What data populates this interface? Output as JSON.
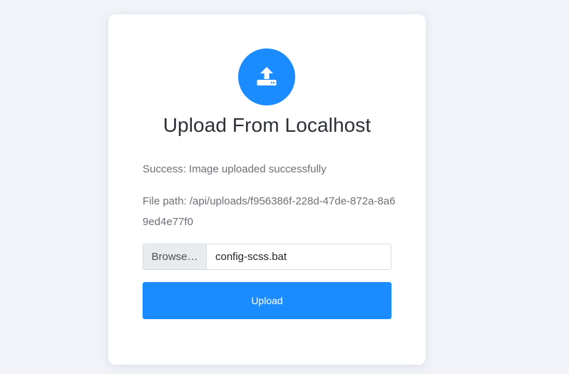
{
  "card": {
    "icon": "upload-icon",
    "title": "Upload From Localhost",
    "success_message": "Success: Image uploaded successfully",
    "file_path": "File path: /api/uploads/f956386f-228d-47de-872a-8a69ed4e77f0",
    "browse_label": "Browse…",
    "selected_file": "config-scss.bat",
    "upload_label": "Upload"
  },
  "colors": {
    "accent": "#1a8cff",
    "background": "#f1f3f9",
    "card": "#ffffff"
  }
}
